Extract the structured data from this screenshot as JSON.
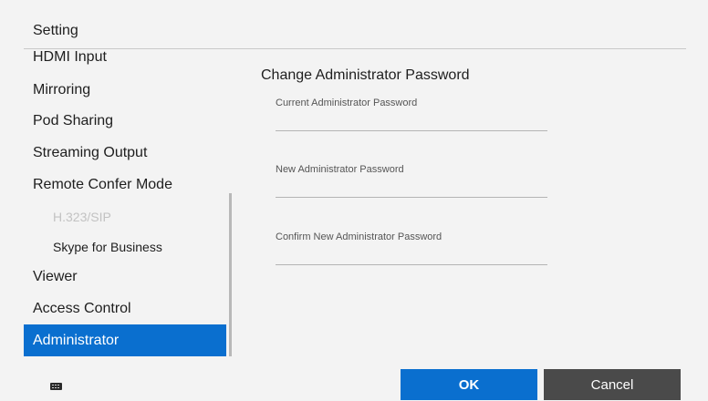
{
  "window": {
    "title": "Setting"
  },
  "sidebar": {
    "items": [
      {
        "label": "HDMI Input",
        "state": "normal"
      },
      {
        "label": "Mirroring",
        "state": "normal"
      },
      {
        "label": "Pod Sharing",
        "state": "normal"
      },
      {
        "label": "Streaming Output",
        "state": "normal"
      },
      {
        "label": "Remote Confer Mode",
        "state": "normal"
      },
      {
        "label": "H.323/SIP",
        "state": "disabled",
        "sub": true
      },
      {
        "label": "Skype for Business",
        "state": "normal",
        "sub": true
      },
      {
        "label": "Viewer",
        "state": "normal"
      },
      {
        "label": "Access Control",
        "state": "normal"
      },
      {
        "label": "Administrator",
        "state": "selected"
      }
    ]
  },
  "panel": {
    "title": "Change Administrator Password",
    "fields": [
      {
        "label": "Current Administrator Password",
        "value": ""
      },
      {
        "label": "New Administrator Password",
        "value": ""
      },
      {
        "label": "Confirm New Administrator Password",
        "value": ""
      }
    ]
  },
  "footer": {
    "keyboard_icon": "keyboard-icon",
    "ok_label": "OK",
    "cancel_label": "Cancel"
  },
  "colors": {
    "accent": "#0a6fcf",
    "background": "#f3f3f3",
    "cancel_button": "#4a4a4a",
    "disabled_text": "#c2c2c2"
  }
}
